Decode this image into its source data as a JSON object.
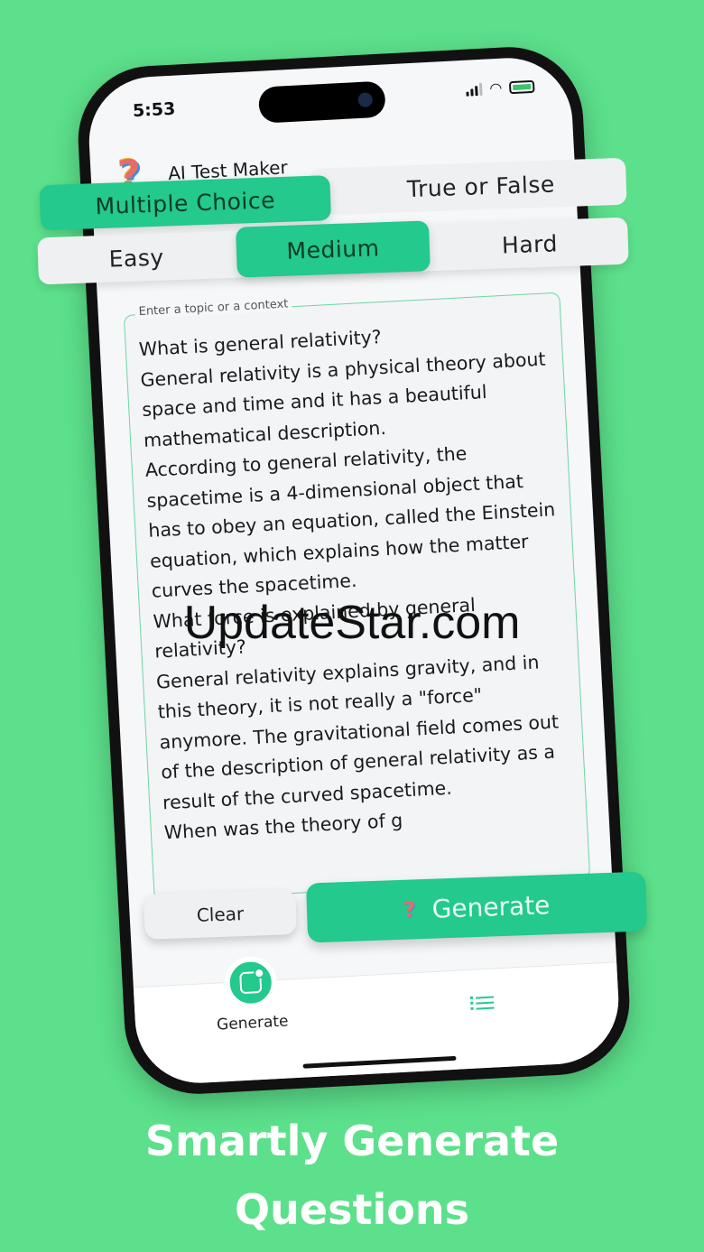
{
  "status_bar": {
    "time": "5:53"
  },
  "app": {
    "title": "AI Test Maker",
    "logo_icon": "question-mark-logo-icon"
  },
  "question_type": {
    "options": [
      "Multiple Choice",
      "True or False"
    ],
    "selected": "Multiple Choice"
  },
  "difficulty": {
    "options": [
      "Easy",
      "Medium",
      "Hard"
    ],
    "selected": "Medium"
  },
  "topic_input": {
    "label": "Enter a topic or a context",
    "value": "What is general relativity?\nGeneral relativity is a physical theory about space and time and it has a beautiful mathematical description.\nAccording to general relativity, the spacetime is a 4-dimensional object that has to obey an equation, called the Einstein equation, which explains how the matter curves the spacetime.\nWhat force is explained by general relativity?\nGeneral relativity explains gravity, and in this theory, it is not really a \"force\" anymore. The gravitational field comes out of the description of general relativity as a result of the curved spacetime.\nWhen was the theory of g"
  },
  "actions": {
    "clear": "Clear",
    "generate": "Generate"
  },
  "bottom_nav": {
    "generate_label": "Generate"
  },
  "watermark": "UpdateStar.com",
  "caption": {
    "line1": "Smartly Generate",
    "line2": "Questions"
  },
  "colors": {
    "background": "#5ce08b",
    "accent": "#23c98d"
  }
}
